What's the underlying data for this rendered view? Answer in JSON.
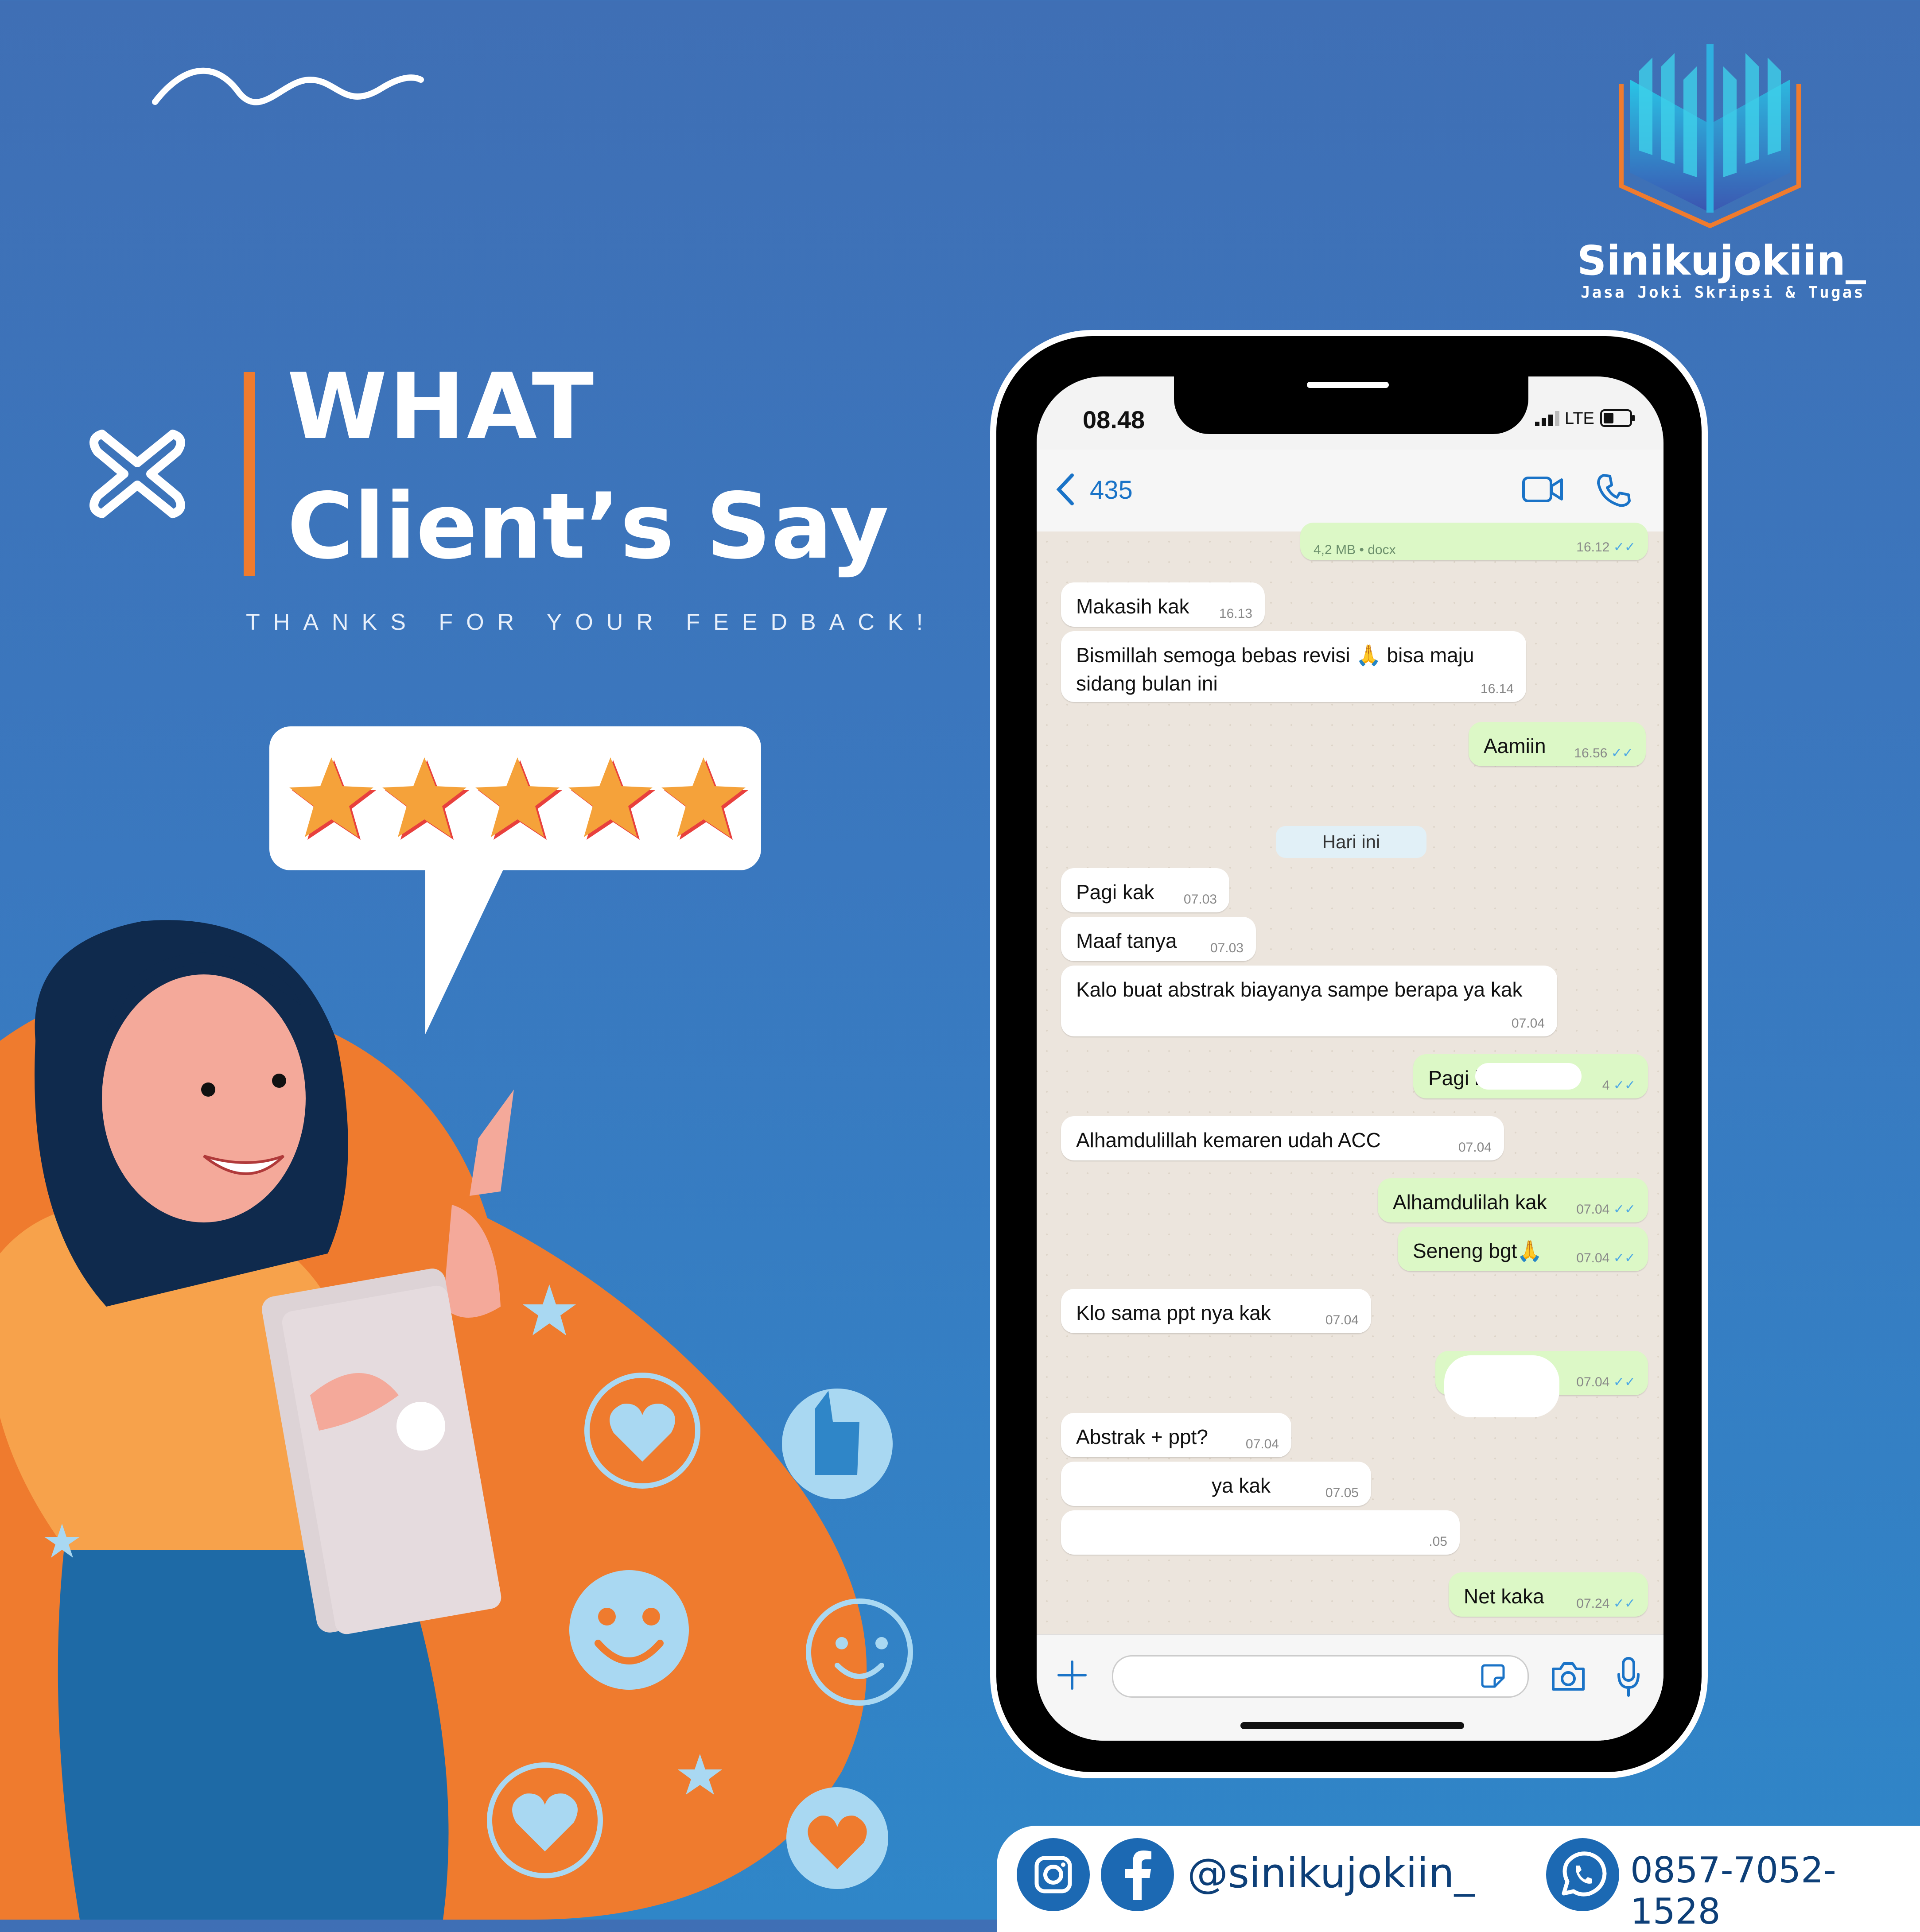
{
  "heading": {
    "line1": "WHAT",
    "line2": "Client’s Say",
    "tagline": "THANKS FOR YOUR FEEDBACK!"
  },
  "brand": {
    "name": "Sinikujokiin_",
    "tagline": "Jasa Joki Skripsi & Tugas",
    "accent": "#ef7b2e",
    "primary": "#3a78bf"
  },
  "rating": {
    "stars": 5,
    "max": 5
  },
  "phone": {
    "status": {
      "time": "08.48",
      "network": "LTE"
    },
    "header": {
      "back_count": "435"
    },
    "day_separator": "Hari ini",
    "messages": [
      {
        "dir": "out",
        "text": "4,2 MB • docx",
        "time": "16.12"
      },
      {
        "dir": "in",
        "text": "Makasih kak",
        "time": "16.13"
      },
      {
        "dir": "in",
        "text": "Bismillah semoga bebas revisi 🙏 bisa maju sidang bulan ini",
        "time": "16.14"
      },
      {
        "dir": "out",
        "text": "Aamiin",
        "time": "16.56"
      },
      {
        "dir": "in",
        "text": "Pagi kak",
        "time": "07.03"
      },
      {
        "dir": "in",
        "text": "Maaf tanya",
        "time": "07.03"
      },
      {
        "dir": "in",
        "text": "Kalo buat abstrak biayanya sampe berapa ya kak",
        "time": "07.04"
      },
      {
        "dir": "out",
        "text": "Pagi k",
        "time": "4"
      },
      {
        "dir": "in",
        "text": "Alhamdulillah kemaren udah ACC",
        "time": "07.04"
      },
      {
        "dir": "out",
        "text": "Alhamdulilah kak",
        "time": "07.04"
      },
      {
        "dir": "out",
        "text": "Seneng bgt🙏",
        "time": "07.04"
      },
      {
        "dir": "in",
        "text": "Klo sama ppt nya kak",
        "time": "07.04"
      },
      {
        "dir": "out",
        "text": "",
        "time": "07.04"
      },
      {
        "dir": "in",
        "text": "Abstrak + ppt?",
        "time": "07.04"
      },
      {
        "dir": "in",
        "text": "ya kak",
        "time": "07.05"
      },
      {
        "dir": "in",
        "text": "",
        "time": ".05"
      },
      {
        "dir": "out",
        "text": "Net kaka",
        "time": "07.24"
      }
    ]
  },
  "footer": {
    "handle": "@sinikujokiin_",
    "whatsapp": "0857-7052-1528",
    "icons": [
      "instagram-icon",
      "facebook-icon",
      "whatsapp-icon"
    ]
  }
}
